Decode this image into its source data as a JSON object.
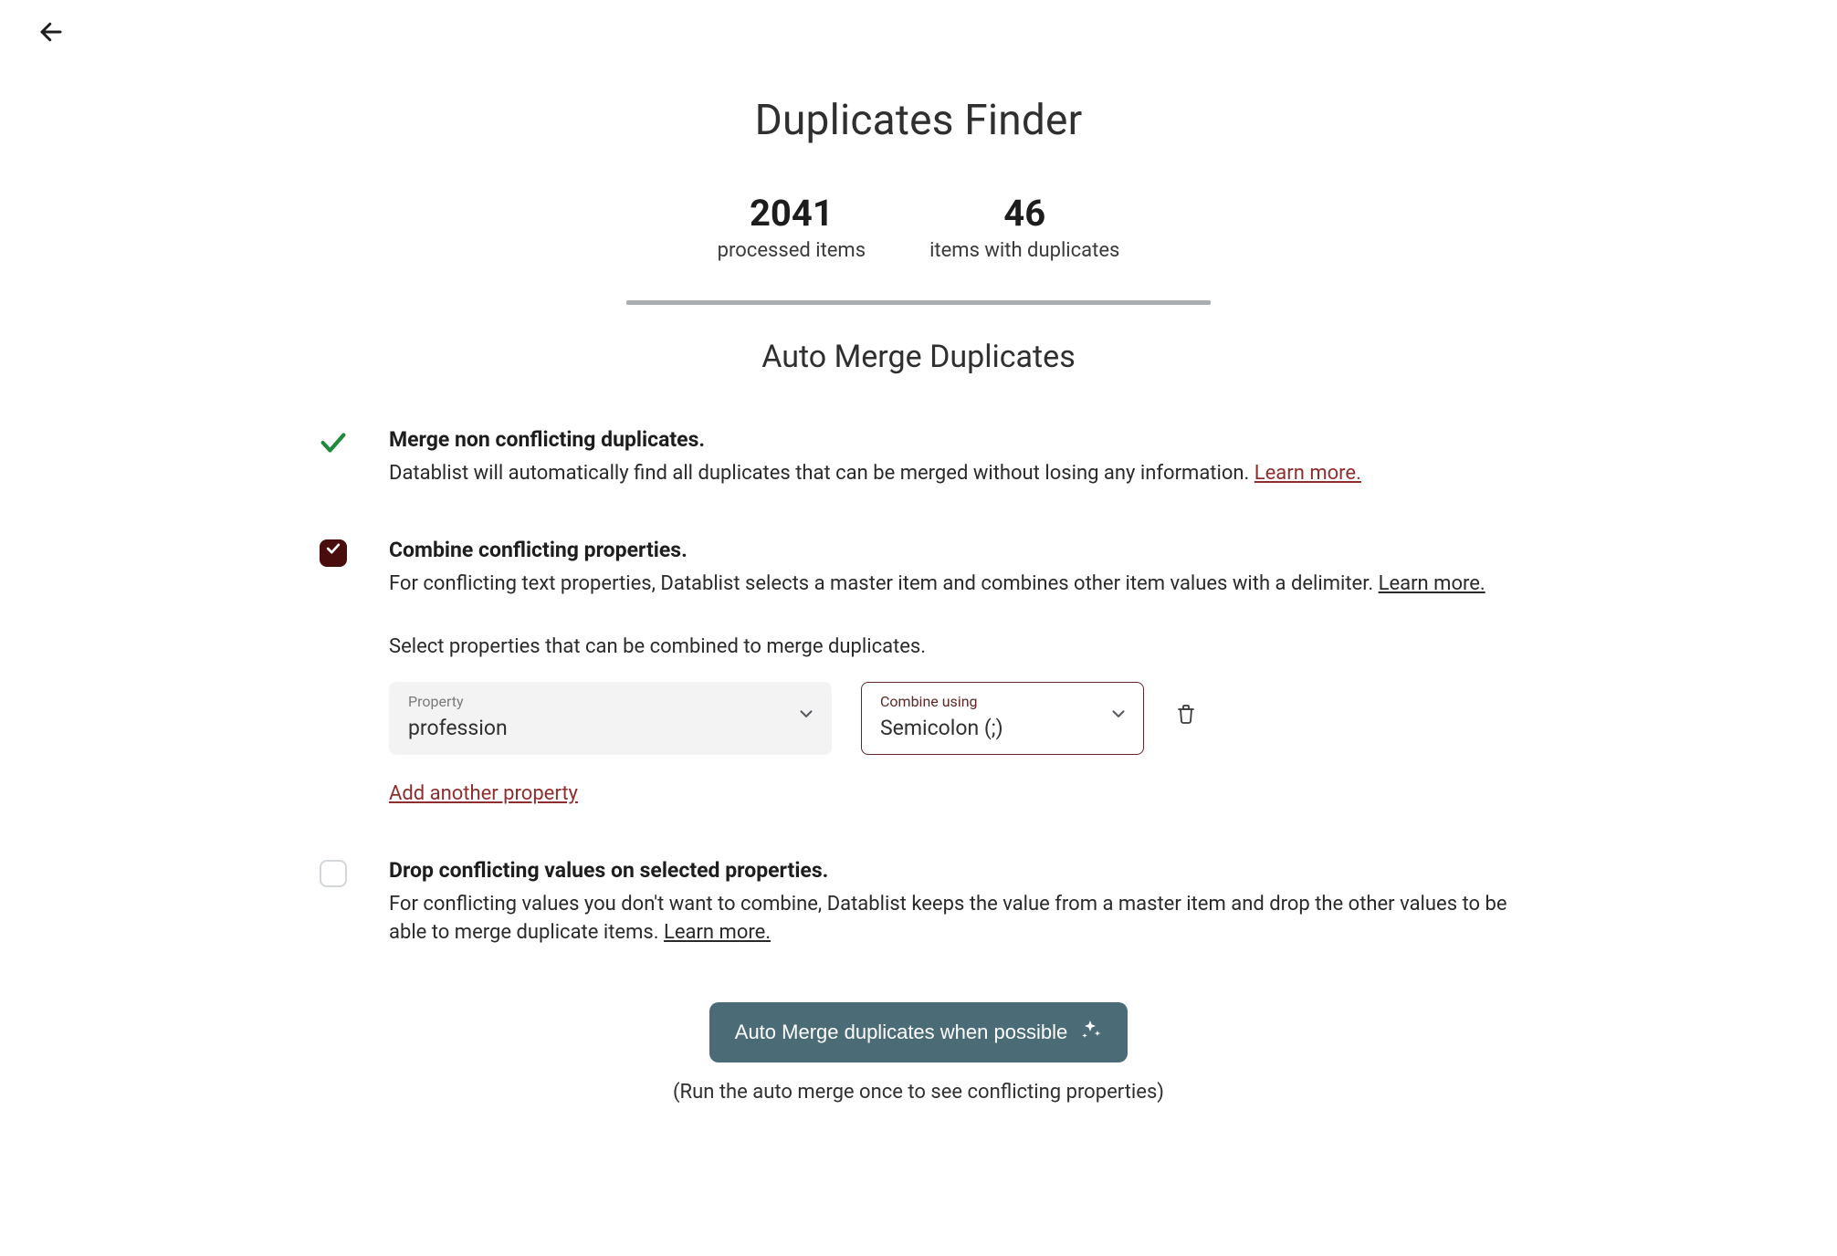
{
  "header": {
    "title": "Duplicates Finder"
  },
  "stats": {
    "processed": {
      "value": "2041",
      "label": "processed items"
    },
    "with_dups": {
      "value": "46",
      "label": "items with duplicates"
    }
  },
  "section": {
    "title": "Auto Merge Duplicates"
  },
  "options": {
    "merge_non_conflicting": {
      "heading": "Merge non conflicting duplicates.",
      "desc": "Datablist will automatically find all duplicates that can be merged without losing any information. ",
      "learn": "Learn more."
    },
    "combine_conflicting": {
      "checked": true,
      "heading": "Combine conflicting properties.",
      "desc_a": "For conflicting text properties, Datablist selects a master item and combines other item values with a delimiter. ",
      "learn": "Learn more.",
      "sub": "Select properties that can be combined to merge duplicates.",
      "property": {
        "label": "Property",
        "value": "profession"
      },
      "delimiter": {
        "label": "Combine using",
        "value": "Semicolon (;)"
      },
      "add_link": "Add another property"
    },
    "drop_conflicting": {
      "checked": false,
      "heading": "Drop conflicting values on selected properties.",
      "desc_a": "For conflicting values you don't want to combine, Datablist keeps the value from a master item and drop the other values to be able to merge duplicate items. ",
      "learn": "Learn more."
    }
  },
  "cta": {
    "button": "Auto Merge duplicates when possible",
    "note": "(Run the auto merge once to see conflicting properties)"
  }
}
